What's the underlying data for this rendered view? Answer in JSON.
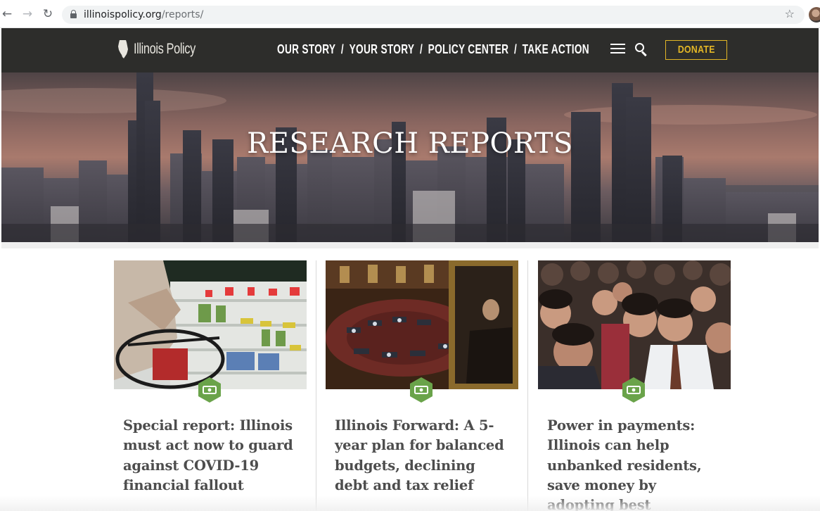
{
  "browser": {
    "url_host": "illinoispolicy.org",
    "url_path": "/reports/",
    "icons": {
      "back": "arrow-left-icon",
      "forward": "arrow-right-icon",
      "reload": "reload-icon",
      "lock": "lock-icon",
      "bookmark": "star-icon"
    }
  },
  "header": {
    "logo_text": "Illinois Policy",
    "nav": [
      "OUR STORY",
      "YOUR STORY",
      "POLICY CENTER",
      "TAKE ACTION"
    ],
    "nav_separator": "/",
    "donate_label": "DONATE",
    "colors": {
      "background": "#2d2d2b",
      "accent": "#e3b626"
    }
  },
  "hero": {
    "title": "RESEARCH REPORTS"
  },
  "cards": [
    {
      "title": "Special report: Illinois must act now to guard against COVID-19 financial fallout",
      "badge_icon": "money-icon",
      "image": "grocery-shopper-photo"
    },
    {
      "title": "Illinois Forward: A 5-year plan for balanced budgets, declining debt and tax relief",
      "badge_icon": "money-icon",
      "image": "legislative-chamber-photo"
    },
    {
      "title": "Power in payments: Illinois can help unbanked residents, save money by adopting best practices in",
      "badge_icon": "money-icon",
      "image": "crowd-photo"
    }
  ],
  "colors": {
    "badge_green": "#6aa34a",
    "title_text": "#4d4d4d"
  }
}
